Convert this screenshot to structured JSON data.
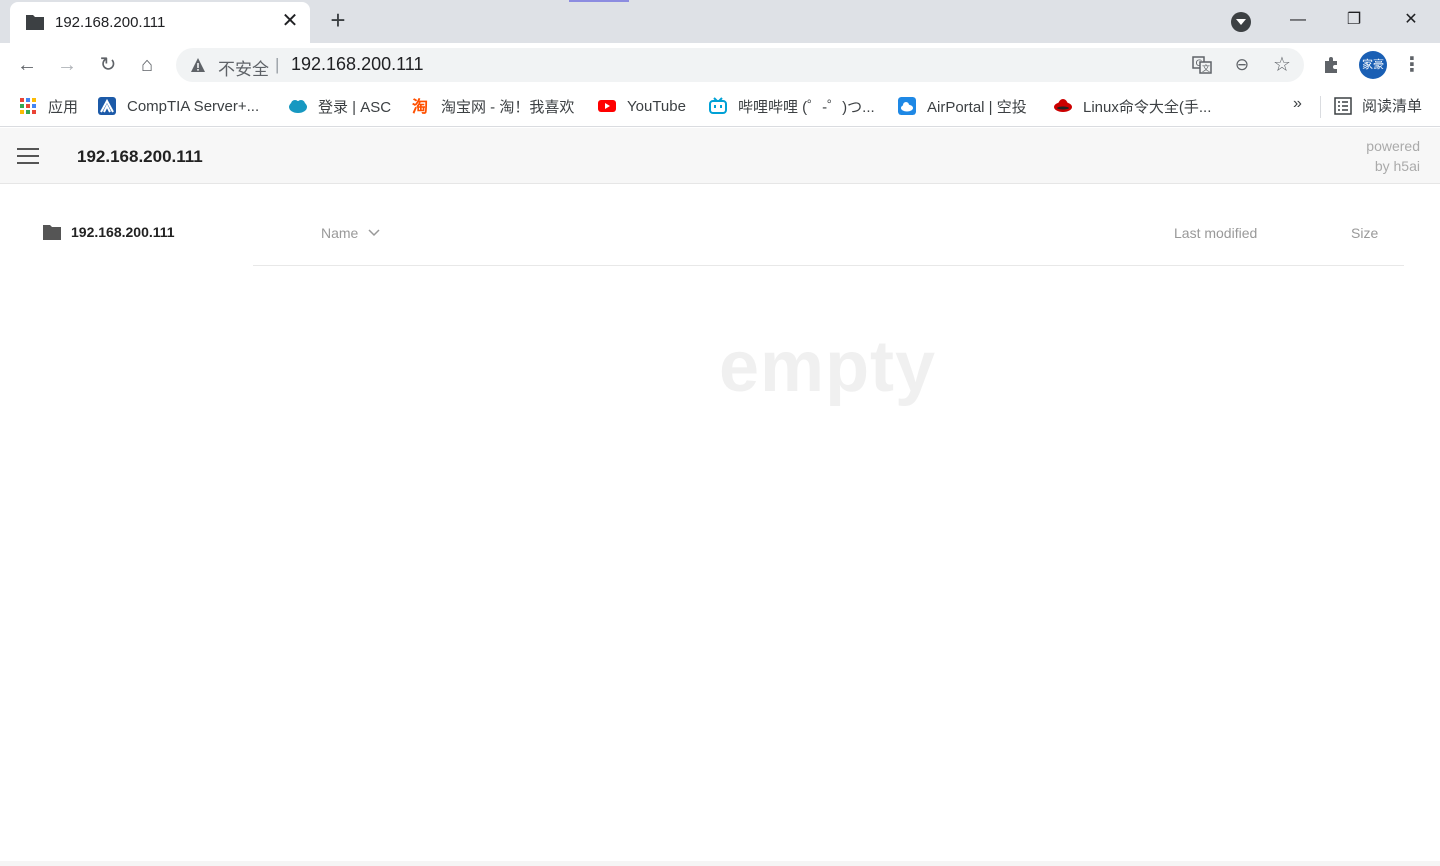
{
  "browser": {
    "tab": {
      "title": "192.168.200.111",
      "close": "✕"
    },
    "new_tab": "+",
    "window": {
      "minimize": "—",
      "restore": "❐",
      "close": "✕"
    },
    "toolbar": {
      "back": "←",
      "forward": "→",
      "reload": "↻",
      "home": "⌂",
      "security_label": "不安全",
      "url": "192.168.200.111",
      "zoom": "⊖",
      "star": "☆",
      "avatar_text": "家豪",
      "menu": "⋮"
    },
    "bookmarks": [
      {
        "label": "应用",
        "icon": "apps-grid-icon",
        "color": "#4285f4"
      },
      {
        "label": "CompTIA Server+...",
        "icon": "comptia-icon",
        "color": "#1c5aa8"
      },
      {
        "label": "登录 | ASC",
        "icon": "salesforce-cloud-icon",
        "color": "#1798c1"
      },
      {
        "label": "淘宝网 - 淘！我喜欢",
        "icon": "taobao-icon",
        "color": "#ff5000"
      },
      {
        "label": "YouTube",
        "icon": "youtube-icon",
        "color": "#ff0000"
      },
      {
        "label": "哔哩哔哩 (゜-゜)つ...",
        "icon": "bilibili-icon",
        "color": "#00a1d6"
      },
      {
        "label": "AirPortal | 空投",
        "icon": "airportal-icon",
        "color": "#1e88e5"
      },
      {
        "label": "Linux命令大全(手...",
        "icon": "redhat-icon",
        "color": "#cc0000"
      }
    ],
    "bookmarks_more": "»",
    "reading_list": "阅读清单"
  },
  "page": {
    "breadcrumb": "192.168.200.111",
    "powered_line1": "powered",
    "powered_line2": "by h5ai",
    "sidebar_folder": "192.168.200.111",
    "columns": {
      "name": "Name",
      "modified": "Last modified",
      "size": "Size"
    },
    "empty_text": "empty"
  }
}
